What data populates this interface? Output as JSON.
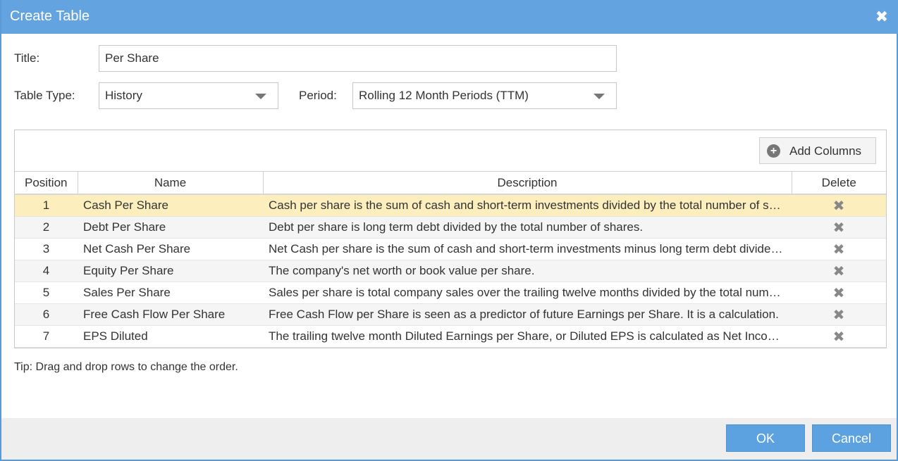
{
  "dialog": {
    "title": "Create Table",
    "close_icon": "close-icon"
  },
  "form": {
    "title_label": "Title:",
    "title_value": "Per Share",
    "table_type_label": "Table Type:",
    "table_type_value": "History",
    "period_label": "Period:",
    "period_value": "Rolling 12 Month Periods (TTM)"
  },
  "grid": {
    "add_columns_label": "Add Columns",
    "columns": [
      "Position",
      "Name",
      "Description",
      "Delete"
    ],
    "rows": [
      {
        "position": "1",
        "name": "Cash Per Share",
        "description": "Cash per share is the sum of cash and short-term investments divided by the total number of shares."
      },
      {
        "position": "2",
        "name": "Debt Per Share",
        "description": "Debt per share is long term debt divided by the total number of shares."
      },
      {
        "position": "3",
        "name": "Net Cash Per Share",
        "description": "Net Cash per share is the sum of cash and short-term investments minus long term debt divided by the total number of shares."
      },
      {
        "position": "4",
        "name": "Equity Per Share",
        "description": "The company's net worth or book value per share."
      },
      {
        "position": "5",
        "name": "Sales Per Share",
        "description": "Sales per share is total company sales over the trailing twelve months divided by the total number of shares."
      },
      {
        "position": "6",
        "name": "Free Cash Flow Per Share",
        "description": "Free Cash Flow per Share is seen as a predictor of future Earnings per Share. It is a calculation."
      },
      {
        "position": "7",
        "name": "EPS Diluted",
        "description": "The trailing twelve month Diluted Earnings per Share, or Diluted EPS is calculated as Net Income divided by diluted shares."
      }
    ],
    "selected_row": 1
  },
  "tip": "Tip: Drag and drop rows to change the order.",
  "footer": {
    "ok_label": "OK",
    "cancel_label": "Cancel"
  },
  "colors": {
    "titlebar": "#63a3e0",
    "selected_row": "#fdefbd",
    "button": "#5da2e0"
  }
}
